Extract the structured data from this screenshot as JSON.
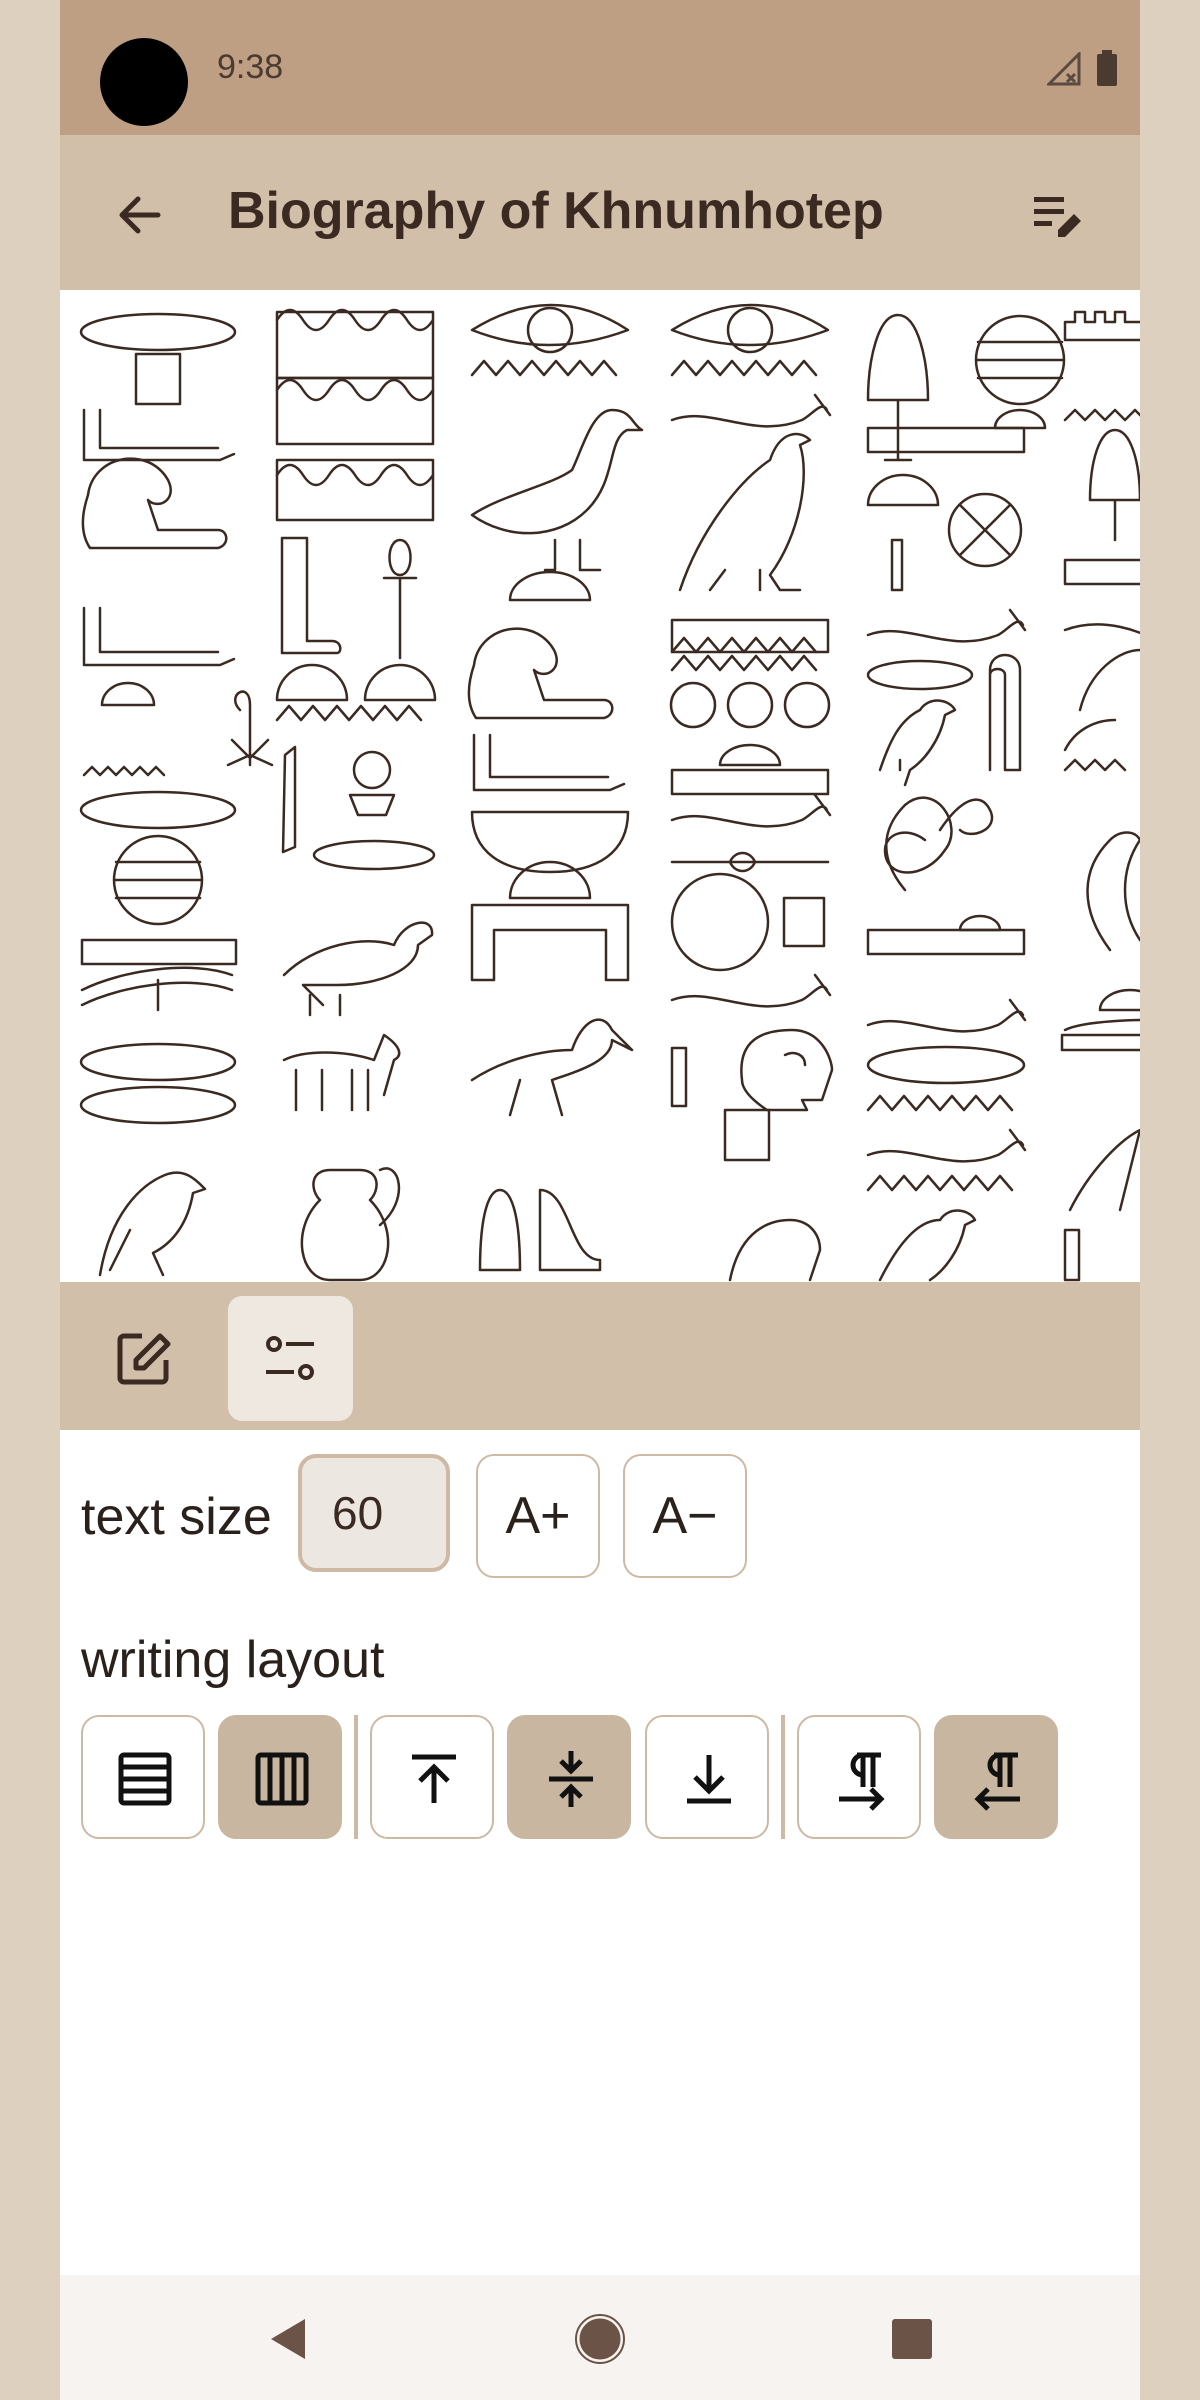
{
  "status": {
    "time": "9:38",
    "icons": [
      "signal-off-icon",
      "battery-icon"
    ]
  },
  "appbar": {
    "title": "Biography of Khnumhotep",
    "back_icon": "arrow-back-icon",
    "action_icon": "edit-list-icon"
  },
  "tabs": [
    {
      "icon": "edit-square-icon",
      "selected": false
    },
    {
      "icon": "tune-settings-icon",
      "selected": true
    }
  ],
  "settings": {
    "text_size_label": "text size",
    "text_size_value": "60",
    "increase_label": "A+",
    "decrease_label": "A−",
    "writing_layout_label": "writing layout",
    "layout_buttons": [
      {
        "icon": "horizontal-lines-icon",
        "selected": false
      },
      {
        "icon": "vertical-columns-icon",
        "selected": true
      },
      {
        "icon": "align-top-icon",
        "selected": false
      },
      {
        "icon": "align-center-icon",
        "selected": true
      },
      {
        "icon": "align-bottom-icon",
        "selected": false
      },
      {
        "icon": "ltr-paragraph-icon",
        "selected": false
      },
      {
        "icon": "rtl-paragraph-icon",
        "selected": true
      }
    ]
  },
  "navbar": {
    "icons": [
      "back-triangle-icon",
      "home-circle-icon",
      "recents-square-icon"
    ]
  },
  "colors": {
    "status": "#bf9f84",
    "appbar": "#d2bfaa",
    "ink": "#3b2a22",
    "selected": "#c9b6a0"
  }
}
